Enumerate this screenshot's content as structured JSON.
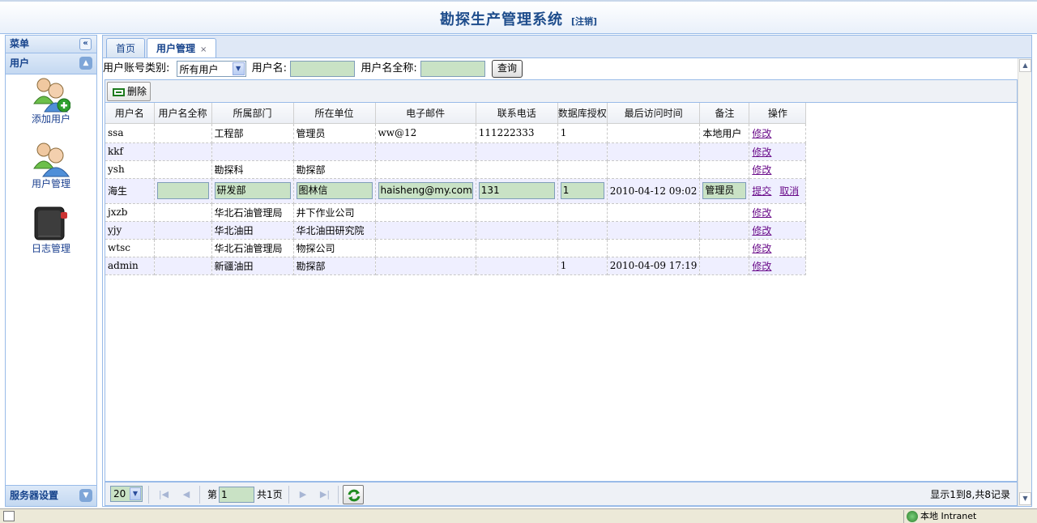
{
  "header": {
    "title": "勘探生产管理系统",
    "logout": "[注销]"
  },
  "sidebar": {
    "menu_title": "菜单",
    "section_title": "用户",
    "items": [
      {
        "label": "添加用户",
        "icon": "add-user-icon"
      },
      {
        "label": "用户管理",
        "icon": "users-icon"
      },
      {
        "label": "日志管理",
        "icon": "log-book-icon"
      }
    ],
    "bottom_section": "服务器设置"
  },
  "tabs": [
    {
      "label": "首页"
    },
    {
      "label": "用户管理",
      "close": "×"
    }
  ],
  "filter": {
    "type_label": "用户账号类别:",
    "type_value": "所有用户",
    "username_label": "用户名:",
    "username_value": "",
    "fullname_label": "用户名全称:",
    "fullname_value": "",
    "query_button": "查询"
  },
  "toolbar": {
    "delete_label": "删除"
  },
  "grid": {
    "columns": [
      "用户名",
      "用户名全称",
      "所属部门",
      "所在单位",
      "电子邮件",
      "联系电话",
      "数据库授权",
      "最后访问时间",
      "备注",
      "操作"
    ],
    "rows": [
      [
        "ssa",
        "",
        "工程部",
        "管理员",
        "ww@12",
        "111222333",
        "1",
        "",
        "本地用户"
      ],
      [
        "kkf",
        "",
        "",
        "",
        "",
        "",
        "",
        "",
        ""
      ],
      [
        "ysh",
        "",
        "勘探科",
        "勘探部",
        "",
        "",
        "",
        "",
        ""
      ],
      [
        "jxzb",
        "",
        "华北石油管理局",
        "井下作业公司",
        "",
        "",
        "",
        "",
        ""
      ],
      [
        "yjy",
        "",
        "华北油田",
        "华北油田研究院",
        "",
        "",
        "",
        "",
        ""
      ],
      [
        "wtsc",
        "",
        "华北石油管理局",
        "物探公司",
        "",
        "",
        "",
        "",
        ""
      ],
      [
        "admin",
        "",
        "新疆油田",
        "勘探部",
        "",
        "",
        "1",
        "2010-04-09 17:19",
        ""
      ]
    ],
    "editing_row": {
      "username": "海生",
      "fullname": "",
      "department": "研发部",
      "unit": "图林信",
      "email": "haisheng@my.com",
      "phone": "131",
      "db_auth": "1",
      "last_access": "2010-04-12 09:02",
      "remark": "管理员",
      "submit": "提交",
      "cancel": "取消"
    },
    "edit_link": "修改"
  },
  "pager": {
    "page_size": "20",
    "page_prefix": "第",
    "page_value": "1",
    "page_suffix": "共1页",
    "info": "显示1到8,共8记录"
  },
  "statusbar": {
    "zone": "本地 Intranet"
  },
  "colors": {
    "accent": "#15428b",
    "border": "#99bbe8",
    "input_bg": "#c9e2c5",
    "alt_row": "#efefff",
    "link": "#6a0c8a"
  }
}
